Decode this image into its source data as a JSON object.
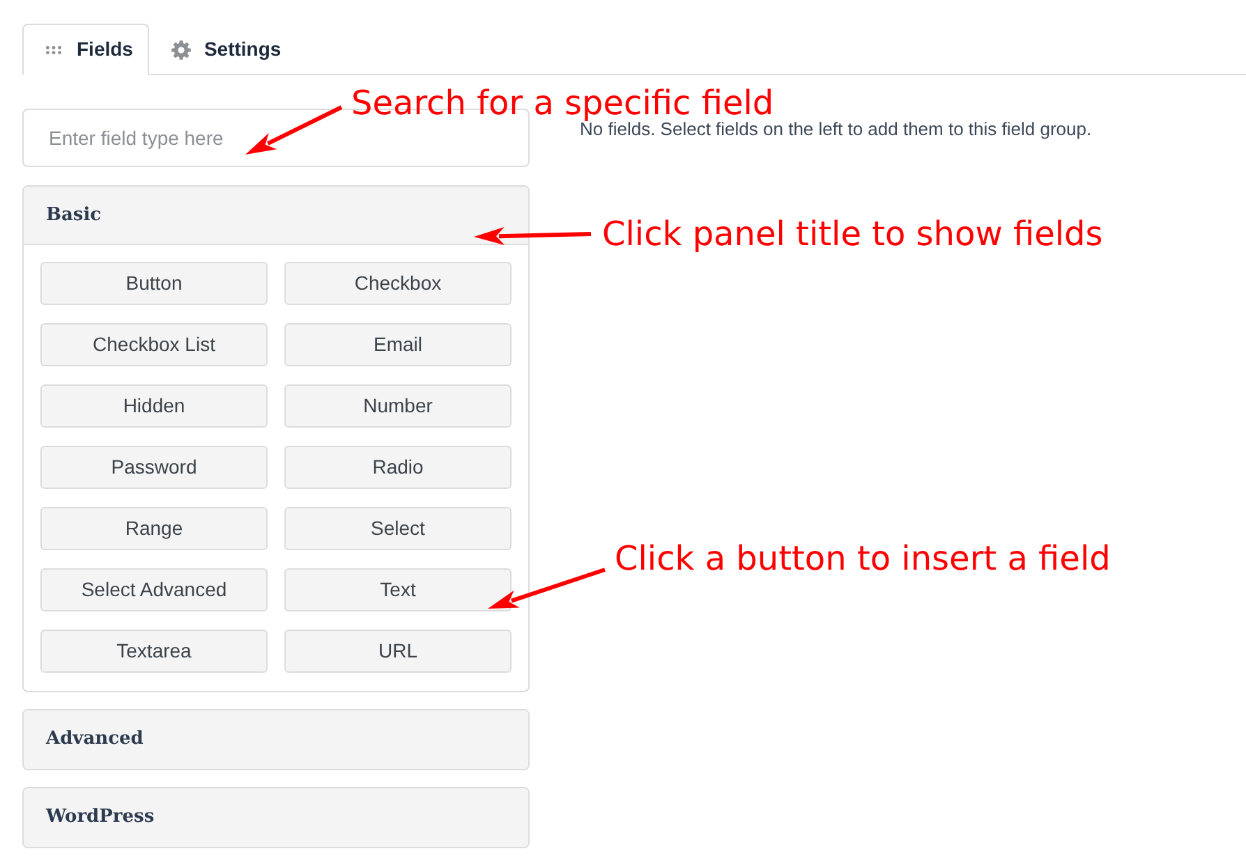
{
  "tabs": [
    {
      "label": "Fields",
      "selected": true
    },
    {
      "label": "Settings",
      "selected": false
    }
  ],
  "search": {
    "placeholder": "Enter field type here"
  },
  "panels": [
    {
      "title": "Basic",
      "expanded": true,
      "buttons": [
        "Button",
        "Checkbox",
        "Checkbox List",
        "Email",
        "Hidden",
        "Number",
        "Password",
        "Radio",
        "Range",
        "Select",
        "Select Advanced",
        "Text",
        "Textarea",
        "URL"
      ]
    },
    {
      "title": "Advanced",
      "expanded": false
    },
    {
      "title": "WordPress",
      "expanded": false
    }
  ],
  "empty_message": "No fields. Select fields on the left to add them to this field group.",
  "annotations": [
    {
      "text": "Search for a specific field"
    },
    {
      "text": "Click panel title to show fields"
    },
    {
      "text": "Click a button to insert a field"
    }
  ]
}
